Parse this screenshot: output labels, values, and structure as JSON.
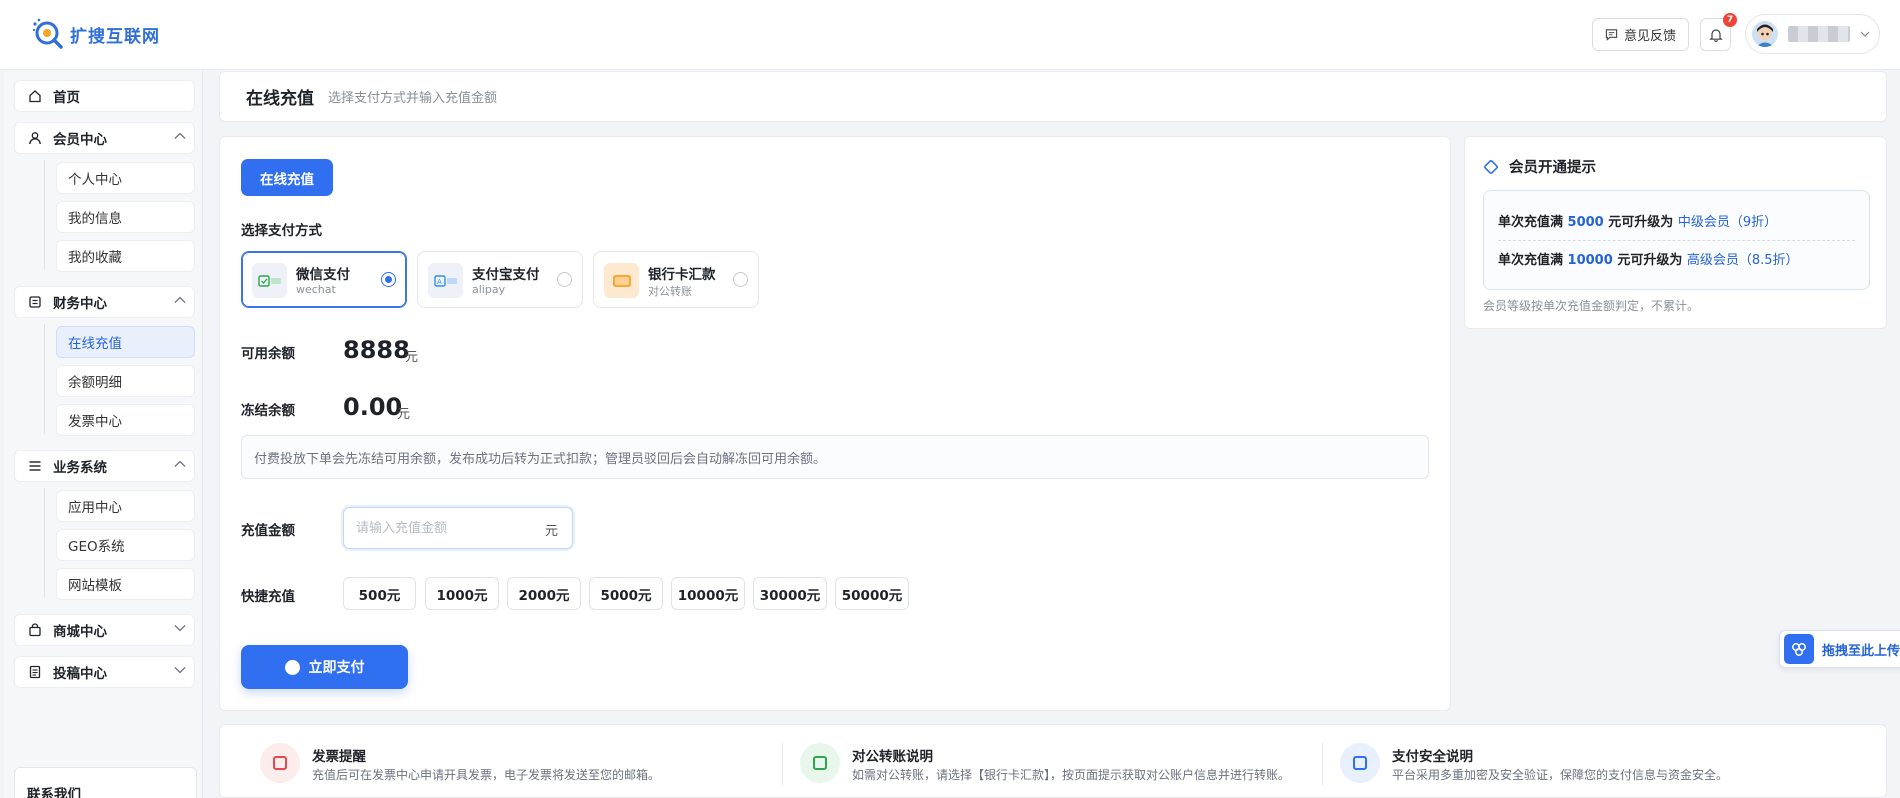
{
  "header": {
    "logo_text": "扩搜互联网",
    "feedback_label": "意见反馈",
    "notification_count": "7",
    "accent_color": "#2f6ff0"
  },
  "sidebar": {
    "home": "首页",
    "member_center": {
      "label": "会员中心",
      "items": [
        "个人中心",
        "我的信息",
        "我的收藏"
      ]
    },
    "finance_center": {
      "label": "财务中心",
      "items": [
        "在线充值",
        "余额明细",
        "发票中心"
      ],
      "active": "在线充值"
    },
    "business_system": {
      "label": "业务系统",
      "items": [
        "应用中心",
        "GEO系统",
        "网站模板"
      ]
    },
    "mall_center": "商城中心",
    "submission_center": "投稿中心",
    "contact": "联系我们"
  },
  "page_title": {
    "title": "在线充值",
    "subtitle": "选择支付方式并输入充值金额"
  },
  "main": {
    "tab_label": "在线充值",
    "payment_method_label": "选择支付方式",
    "payment_methods": [
      {
        "name": "微信支付",
        "sub": "wechat",
        "selected": true,
        "icon": "wechat-icon"
      },
      {
        "name": "支付宝支付",
        "sub": "alipay",
        "selected": false,
        "icon": "alipay-icon"
      },
      {
        "name": "银行卡汇款",
        "sub": "对公转账",
        "selected": false,
        "icon": "bank-card-icon"
      }
    ],
    "available_balance_label": "可用余额",
    "available_balance": "8888",
    "frozen_balance_label": "冻结余额",
    "frozen_balance": "0.00",
    "currency_unit": "元",
    "notice": "付费投放下单会先冻结可用余额，发布成功后转为正式扣款；管理员驳回后会自动解冻回可用余额。",
    "amount_label": "充值金额",
    "amount_placeholder": "请输入充值金额",
    "quick_label": "快捷充值",
    "quick_amounts": [
      "500元",
      "1000元",
      "2000元",
      "5000元",
      "10000元",
      "30000元",
      "50000元"
    ],
    "pay_button": "立即支付"
  },
  "membership": {
    "title": "会员开通提示",
    "tiers": [
      {
        "prefix": "单次充值满",
        "amount": "5000",
        "middle": "元可升级为",
        "level": "中级会员（9折）"
      },
      {
        "prefix": "单次充值满",
        "amount": "10000",
        "middle": "元可升级为",
        "level": "高级会员（8.5折）"
      }
    ],
    "note": "会员等级按单次充值金额判定，不累计。"
  },
  "upload_float": "拖拽至此上传",
  "bottom": [
    {
      "title": "发票提醒",
      "desc": "充值后可在发票中心申请开具发票，电子发票将发送至您的邮箱。",
      "color": "#e5484d",
      "bg": "#fdecec"
    },
    {
      "title": "对公转账说明",
      "desc": "如需对公转账，请选择【银行卡汇款】，按页面提示获取对公账户信息并进行转账。",
      "color": "#2ea44f",
      "bg": "#e8f6ec"
    },
    {
      "title": "支付安全说明",
      "desc": "平台采用多重加密及安全验证，保障您的支付信息与资金安全。",
      "color": "#2f6ff0",
      "bg": "#e9f0fd"
    }
  ]
}
